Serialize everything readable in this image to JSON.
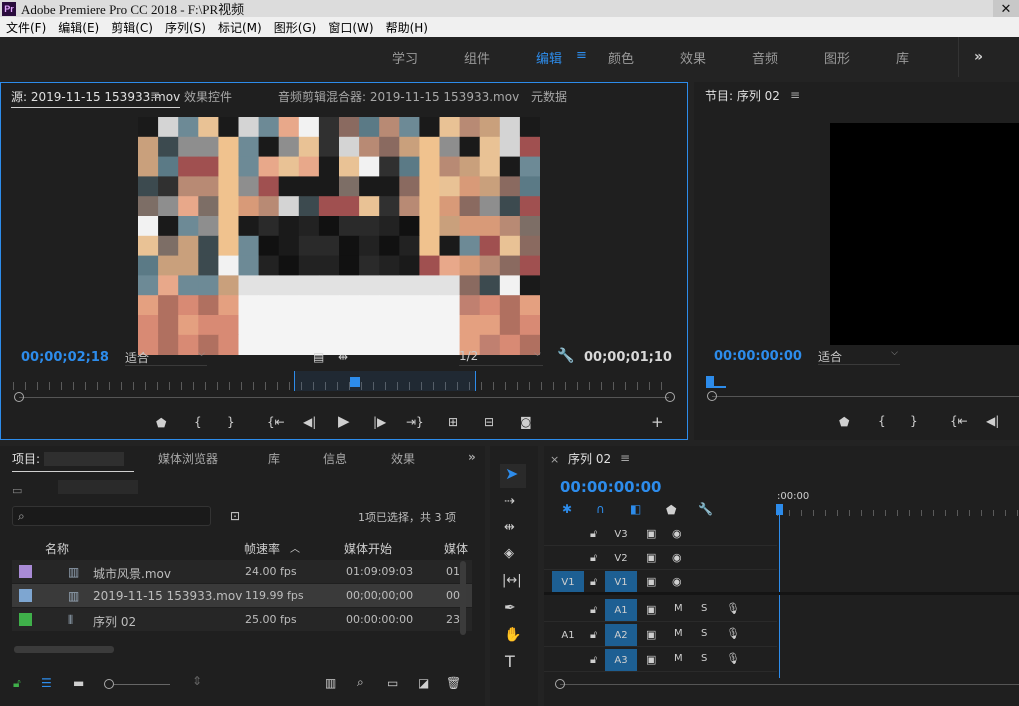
{
  "window": {
    "title": "Adobe Premiere Pro CC 2018 - F:\\PR视频",
    "logo": "Pr",
    "close": "✕"
  },
  "menu": [
    "文件(F)",
    "编辑(E)",
    "剪辑(C)",
    "序列(S)",
    "标记(M)",
    "图形(G)",
    "窗口(W)",
    "帮助(H)"
  ],
  "workspaces": {
    "items": [
      "学习",
      "组件",
      "编辑",
      "颜色",
      "效果",
      "音频",
      "图形",
      "库"
    ],
    "active": "编辑",
    "more": "»"
  },
  "source": {
    "tabs": [
      "源: 2019-11-15 153933.mov",
      "效果控件",
      "音频剪辑混合器: 2019-11-15 153933.mov",
      "元数据"
    ],
    "timecode_in": "00;00;02;18",
    "fit": "适合",
    "resolution": "1/2",
    "timecode_duration": "00;00;01;10"
  },
  "program": {
    "tab": "节目: 序列 02",
    "timecode": "00:00:00:00",
    "fit": "适合"
  },
  "project": {
    "tabs": [
      "项目:",
      "媒体浏览器",
      "库",
      "信息",
      "效果"
    ],
    "selection_info": "1项已选择，共 3 项",
    "columns": [
      "名称",
      "帧速率",
      "媒体开始",
      "媒体"
    ],
    "items": [
      {
        "name": "城市风景.mov",
        "fps": "24.00 fps",
        "start": "01:09:09:03",
        "media": "01",
        "color": "#a98bd6",
        "icon": "film-clip-icon"
      },
      {
        "name": "2019-11-15 153933.mov",
        "fps": "119.99 fps",
        "start": "00;00;00;00",
        "media": "00",
        "color": "#7ea6d1",
        "icon": "film-clip-icon"
      },
      {
        "name": "序列 02",
        "fps": "25.00 fps",
        "start": "00:00:00:00",
        "media": "23",
        "color": "#3fb04a",
        "icon": "sequence-icon"
      }
    ]
  },
  "timeline": {
    "tab": "序列 02",
    "close": "×",
    "timecode": "00:00:00:00",
    "ruler_label": ":00:00",
    "video_tracks": [
      "V3",
      "V2",
      "V1"
    ],
    "audio_tracks": [
      "A1",
      "A2",
      "A3"
    ],
    "source_patch_video": "V1",
    "source_patch_audio": "A1",
    "mute": "M",
    "solo": "S"
  },
  "colors": {
    "accent": "#2d8ceb",
    "track_active": "#1d5f93"
  }
}
